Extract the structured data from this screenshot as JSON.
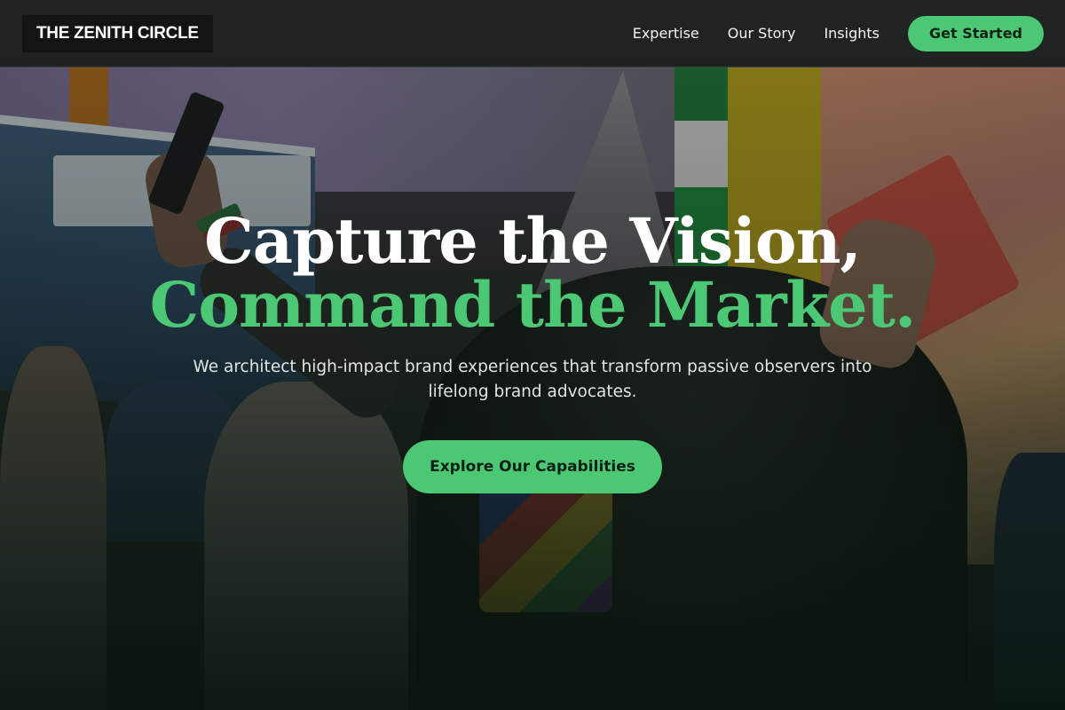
{
  "header": {
    "brand": "THE ZENITH CIRCLE",
    "nav": [
      {
        "label": "Expertise"
      },
      {
        "label": "Our Story"
      },
      {
        "label": "Insights"
      }
    ],
    "cta_label": "Get Started"
  },
  "hero": {
    "headline_line1": "Capture the Vision,",
    "headline_line2": "Command the Market.",
    "subtitle": "We architect high-impact brand experiences that transform passive observers into lifelong brand advocates.",
    "cta_label": "Explore Our Capabilities",
    "background_image": "crowd-at-brand-event-photo"
  },
  "colors": {
    "accent": "#4cc774",
    "header_bg": "#1c221e",
    "text_light": "#ffffff"
  }
}
